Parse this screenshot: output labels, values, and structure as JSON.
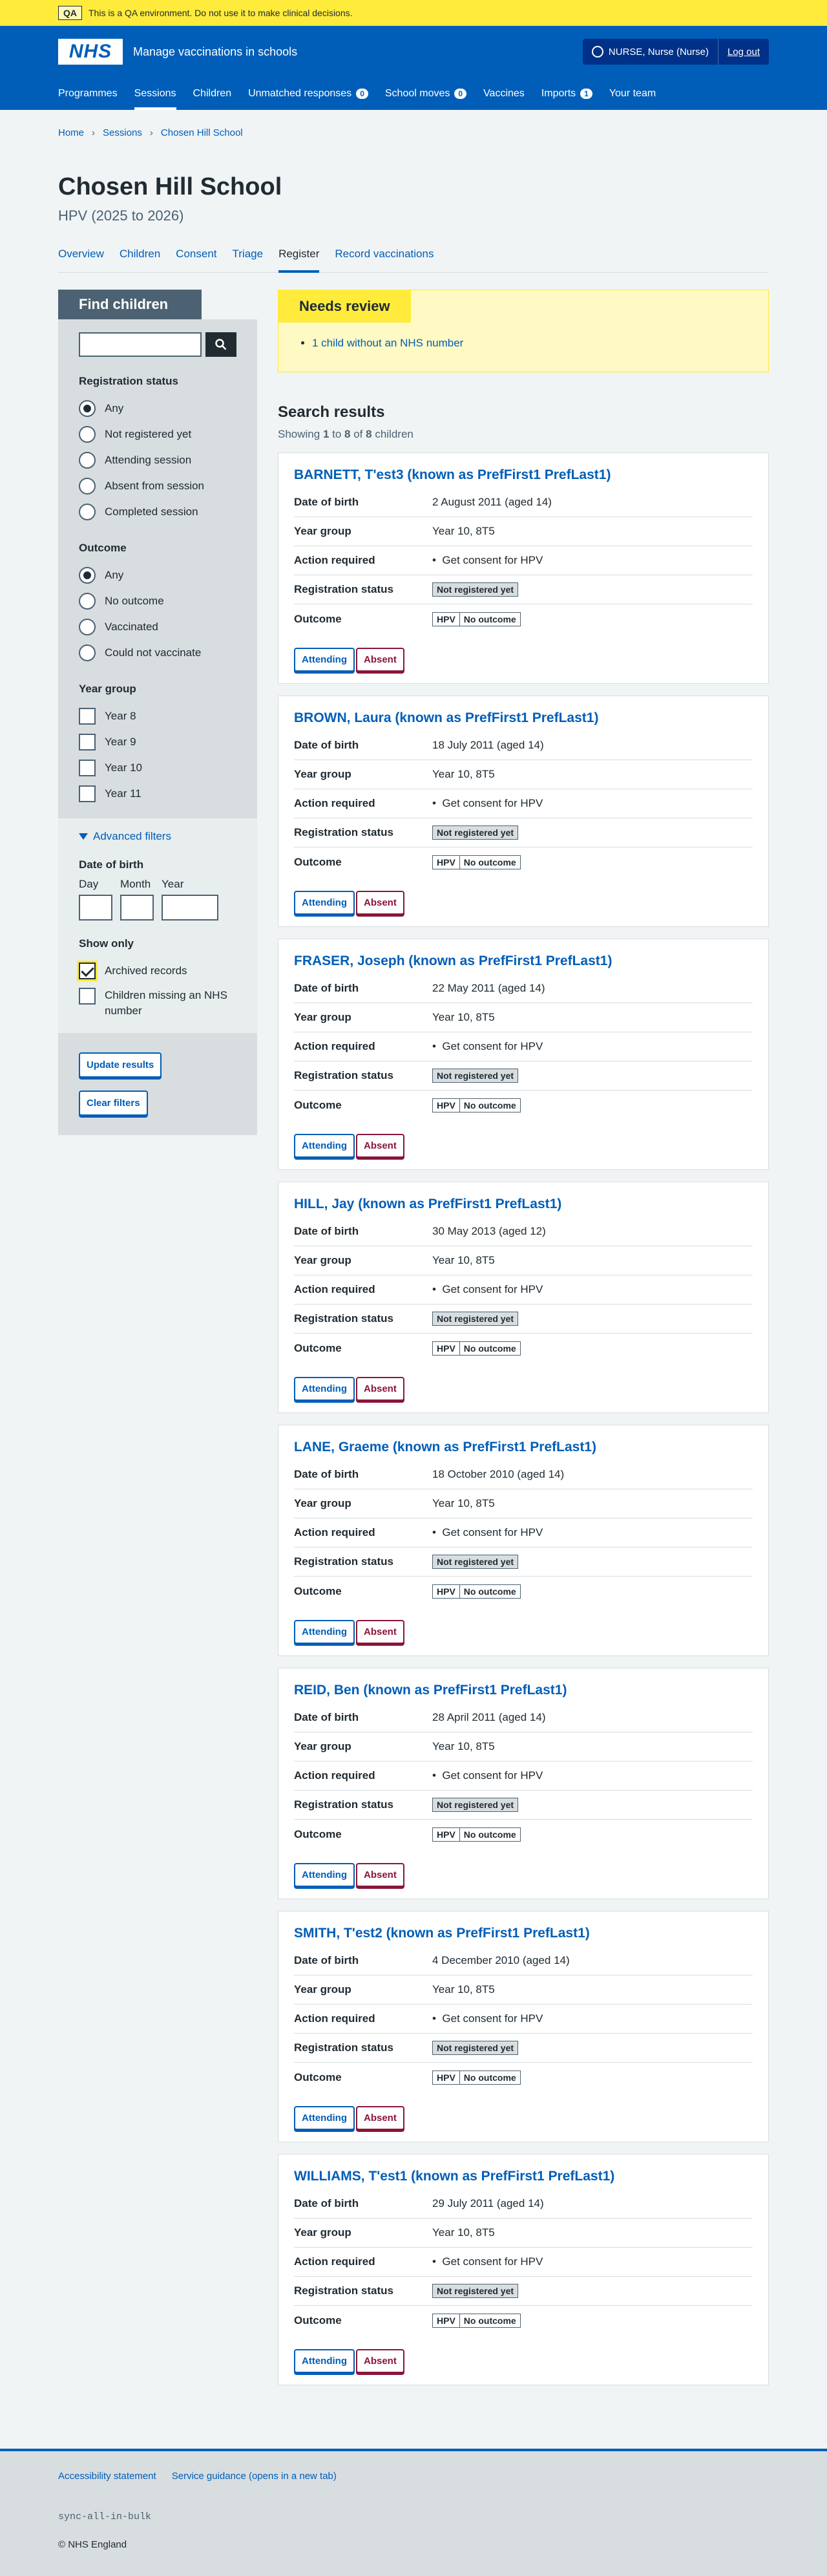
{
  "qa": {
    "tag": "QA",
    "text": "This is a QA environment. Do not use it to make clinical decisions."
  },
  "header": {
    "logo": "NHS",
    "service": "Manage vaccinations in schools",
    "user": "NURSE, Nurse (Nurse)",
    "logout": "Log out"
  },
  "nav": [
    {
      "label": "Programmes"
    },
    {
      "label": "Sessions"
    },
    {
      "label": "Children"
    },
    {
      "label": "Unmatched responses",
      "count": "0"
    },
    {
      "label": "School moves",
      "count": "0"
    },
    {
      "label": "Vaccines"
    },
    {
      "label": "Imports",
      "count": "1"
    },
    {
      "label": "Your team"
    }
  ],
  "breadcrumbs": [
    "Home",
    "Sessions",
    "Chosen Hill School"
  ],
  "page": {
    "title": "Chosen Hill School",
    "subtitle": "HPV (2025 to 2026)"
  },
  "tabs": [
    "Overview",
    "Children",
    "Consent",
    "Triage",
    "Register",
    "Record vaccinations"
  ],
  "filters": {
    "heading": "Find children",
    "reg_legend": "Registration status",
    "reg_options": [
      "Any",
      "Not registered yet",
      "Attending session",
      "Absent from session",
      "Completed session"
    ],
    "outcome_legend": "Outcome",
    "outcome_options": [
      "Any",
      "No outcome",
      "Vaccinated",
      "Could not vaccinate"
    ],
    "year_legend": "Year group",
    "year_options": [
      "Year 8",
      "Year 9",
      "Year 10",
      "Year 11"
    ],
    "advanced": "Advanced filters",
    "dob_legend": "Date of birth",
    "day": "Day",
    "month": "Month",
    "year": "Year",
    "show_only": "Show only",
    "archived": "Archived records",
    "missing_nhs": "Children missing an NHS number",
    "update": "Update results",
    "clear": "Clear filters"
  },
  "review": {
    "heading": "Needs review",
    "item": "1 child without an NHS number"
  },
  "results": {
    "heading": "Search results",
    "prefix": "Showing ",
    "from": "1",
    "to_word": " to ",
    "to": "8",
    "of_word": " of ",
    "total": "8",
    "suffix": " children"
  },
  "labels": {
    "dob": "Date of birth",
    "year": "Year group",
    "action": "Action required",
    "reg": "Registration status",
    "outcome": "Outcome",
    "attending": "Attending",
    "absent": "Absent"
  },
  "children": [
    {
      "name": "BARNETT, T'est3 (known as PrefFirst1 PrefLast1)",
      "dob": "2 August 2011 (aged 14)",
      "year": "Year 10, 8T5",
      "action": "Get consent for HPV",
      "reg": "Not registered yet",
      "prog": "HPV",
      "outcome": "No outcome"
    },
    {
      "name": "BROWN, Laura (known as PrefFirst1 PrefLast1)",
      "dob": "18 July 2011 (aged 14)",
      "year": "Year 10, 8T5",
      "action": "Get consent for HPV",
      "reg": "Not registered yet",
      "prog": "HPV",
      "outcome": "No outcome"
    },
    {
      "name": "FRASER, Joseph (known as PrefFirst1 PrefLast1)",
      "dob": "22 May 2011 (aged 14)",
      "year": "Year 10, 8T5",
      "action": "Get consent for HPV",
      "reg": "Not registered yet",
      "prog": "HPV",
      "outcome": "No outcome"
    },
    {
      "name": "HILL, Jay (known as PrefFirst1 PrefLast1)",
      "dob": "30 May 2013 (aged 12)",
      "year": "Year 10, 8T5",
      "action": "Get consent for HPV",
      "reg": "Not registered yet",
      "prog": "HPV",
      "outcome": "No outcome"
    },
    {
      "name": "LANE, Graeme (known as PrefFirst1 PrefLast1)",
      "dob": "18 October 2010 (aged 14)",
      "year": "Year 10, 8T5",
      "action": "Get consent for HPV",
      "reg": "Not registered yet",
      "prog": "HPV",
      "outcome": "No outcome"
    },
    {
      "name": "REID, Ben (known as PrefFirst1 PrefLast1)",
      "dob": "28 April 2011 (aged 14)",
      "year": "Year 10, 8T5",
      "action": "Get consent for HPV",
      "reg": "Not registered yet",
      "prog": "HPV",
      "outcome": "No outcome"
    },
    {
      "name": "SMITH, T'est2 (known as PrefFirst1 PrefLast1)",
      "dob": "4 December 2010 (aged 14)",
      "year": "Year 10, 8T5",
      "action": "Get consent for HPV",
      "reg": "Not registered yet",
      "prog": "HPV",
      "outcome": "No outcome"
    },
    {
      "name": "WILLIAMS, T'est1 (known as PrefFirst1 PrefLast1)",
      "dob": "29 July 2011 (aged 14)",
      "year": "Year 10, 8T5",
      "action": "Get consent for HPV",
      "reg": "Not registered yet",
      "prog": "HPV",
      "outcome": "No outcome"
    }
  ],
  "footer": {
    "links": [
      "Accessibility statement",
      "Service guidance (opens in a new tab)"
    ],
    "code": "sync-all-in-bulk",
    "copyright": "© NHS England"
  }
}
